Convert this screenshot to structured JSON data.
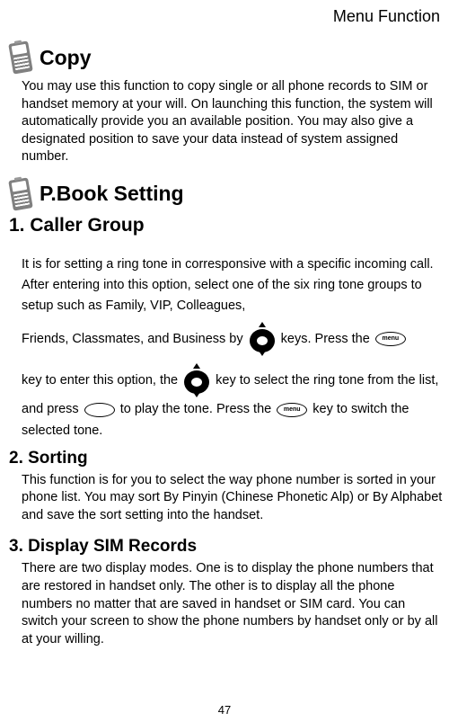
{
  "header": "Menu Function",
  "section1": {
    "title": "Copy",
    "body": "You may use this function to copy single or all phone records to SIM or handset memory at your will. On launching this function, the system will automatically provide you an available position. You may also give a designated position to save your data instead of system assigned number."
  },
  "section2": {
    "title": "P.Book Setting"
  },
  "sub1": {
    "title": "1. Caller Group",
    "p1a": "It is for setting a ring tone in corresponsive with a specific incoming call. After entering into this option, select one of the six ring tone groups to setup such as Family, VIP, Colleagues,",
    "p1b_1": "Friends, Classmates, and Business by ",
    "p1b_2": " keys. Press the ",
    "p1c_1": "key to enter this option, the ",
    "p1c_2": " key to select the ring tone from the list, and press ",
    "p1c_3": " to play the tone.    Press the ",
    "p1c_4": " key to switch the selected tone."
  },
  "sub2": {
    "title": "2. Sorting",
    "body": "This function is for you to select the way phone number is sorted in your phone list. You may sort By Pinyin (Chinese Phonetic Alp) or By Alphabet and save the sort setting into the handset."
  },
  "sub3": {
    "title": "3. Display SIM Records",
    "body": "There are two display modes.      One is to display the phone numbers that are restored in handset only.      The other is to display all the phone numbers no matter that are saved in handset or SIM card.      You can switch your screen to show the phone numbers by handset only or by all at your willing."
  },
  "page_number": "47"
}
